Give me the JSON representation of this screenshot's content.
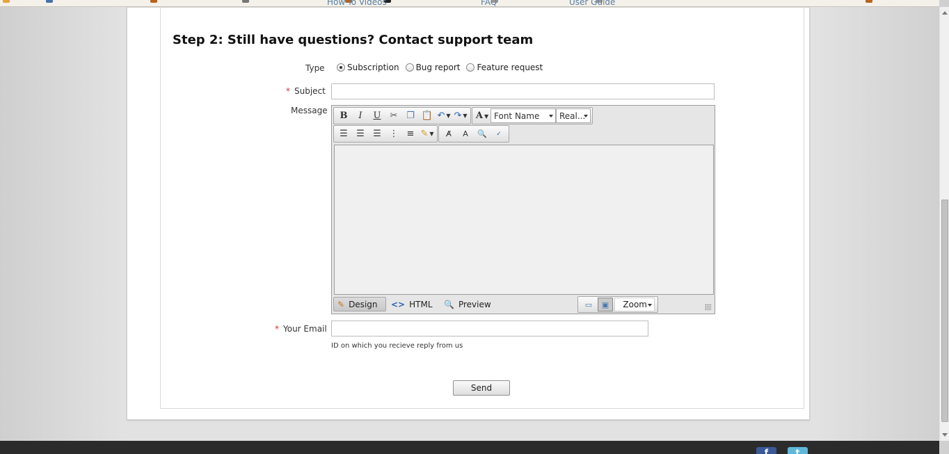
{
  "footer_links": [
    "How-To Videos",
    "FAQ",
    "User Guide"
  ],
  "step": {
    "title": "Step 2: Still have questions? Contact support team"
  },
  "form": {
    "type_label": "Type",
    "type_options": [
      "Subscription",
      "Bug report",
      "Feature request"
    ],
    "type_selected": "Subscription",
    "subject_label": "Subject",
    "subject_value": "",
    "message_label": "Message",
    "email_label": "Your Email",
    "email_value": "",
    "email_hint": "ID on which you recieve reply from us",
    "required_mark": "*",
    "send_label": "Send"
  },
  "editor": {
    "toolbar_row1": [
      "bold-icon",
      "italic-icon",
      "underline-icon",
      "cut-icon",
      "copy-icon",
      "paste-icon",
      "undo-icon",
      "redo-icon",
      "font-color-icon"
    ],
    "font_name": "Font Name",
    "font_size": "Real...",
    "toolbar_row2": [
      "align-left-icon",
      "align-center-icon",
      "align-right-icon",
      "bullet-list-icon",
      "numbered-list-icon",
      "highlight-icon",
      "remove-format-icon",
      "format-icon",
      "find-icon",
      "spellcheck-icon"
    ],
    "modes": [
      "Design",
      "HTML",
      "Preview"
    ],
    "active_mode": "Design",
    "zoom_label": "Zoom"
  },
  "social": {
    "facebook": "f",
    "twitter": "t"
  }
}
